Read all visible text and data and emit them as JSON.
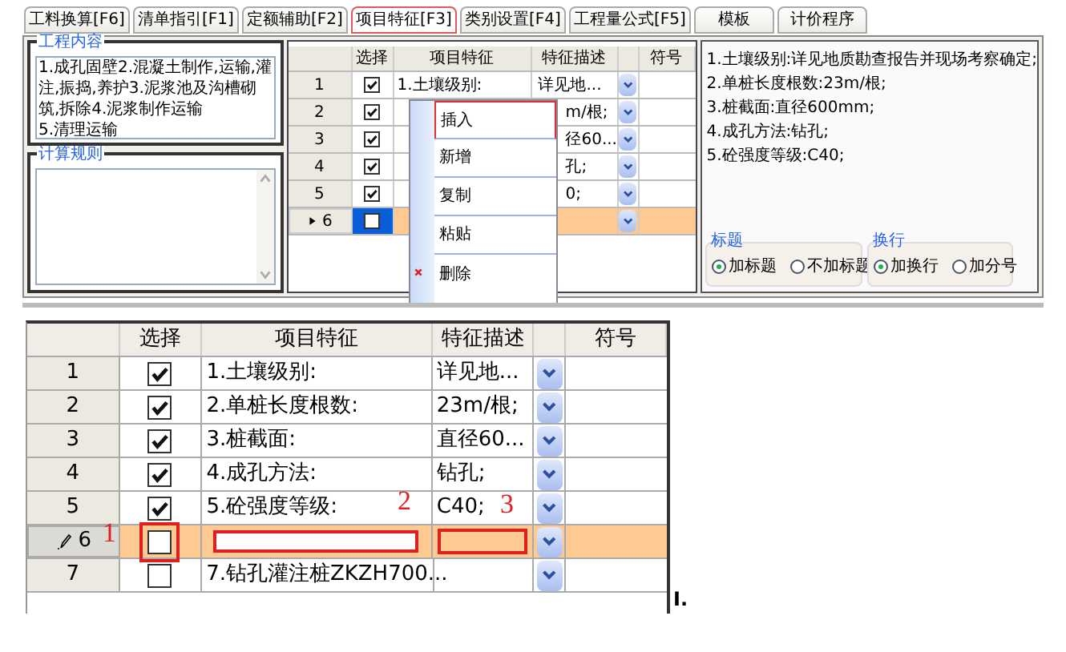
{
  "tabs": [
    {
      "label": "工料换算[F6]",
      "selected": false
    },
    {
      "label": "清单指引[F1]",
      "selected": false
    },
    {
      "label": "定额辅助[F2]",
      "selected": false
    },
    {
      "label": "项目特征[F3]",
      "selected": true
    },
    {
      "label": "类别设置[F4]",
      "selected": false
    },
    {
      "label": "工程量公式[F5]",
      "selected": false
    },
    {
      "label": "模板",
      "selected": false
    },
    {
      "label": "计价程序",
      "selected": false
    }
  ],
  "work_content": {
    "title": "工程内容",
    "text": "1.成孔固壁2.混凝土制作,运输,灌注,振捣,养护3.泥浆池及沟槽砌筑,拆除4.泥浆制作运输\n5.清理运输"
  },
  "calc_rules": {
    "title": "计算规则"
  },
  "top_grid": {
    "columns": [
      "选择",
      "项目特征",
      "特征描述",
      "符号"
    ],
    "rows": [
      {
        "number": "1",
        "checked": true,
        "item": "1.土壤级别:",
        "desc": "详见地...",
        "current": false
      },
      {
        "number": "2",
        "checked": true,
        "desc": "m/根;",
        "current": false
      },
      {
        "number": "3",
        "checked": true,
        "desc": "径60...",
        "current": false
      },
      {
        "number": "4",
        "checked": true,
        "desc": "孔;",
        "current": false
      },
      {
        "number": "5",
        "checked": true,
        "desc": "0;",
        "current": false
      },
      {
        "number": "6",
        "checked": false,
        "current": true
      }
    ]
  },
  "context_menu": {
    "items": [
      {
        "label": "插入",
        "selected": true,
        "kind": "plain"
      },
      {
        "label": "新增",
        "selected": false,
        "kind": "plain"
      },
      {
        "label": "复制",
        "selected": false,
        "kind": "plain"
      },
      {
        "label": "粘贴",
        "selected": false,
        "kind": "plain"
      },
      {
        "label": "删除",
        "selected": false,
        "kind": "delete"
      }
    ]
  },
  "description_panel": {
    "lines": [
      "1.土壤级别:详见地质勘查报告并现场考察确定;",
      "2.单桩长度根数:23m/根;",
      "3.桩截面:直径600mm;",
      "4.成孔方法:钻孔;",
      "5.砼强度等级:C40;"
    ]
  },
  "option_groups": [
    {
      "title": "标题",
      "options": [
        {
          "label": "加标题",
          "selected": true
        },
        {
          "label": "不加标题",
          "selected": false
        }
      ]
    },
    {
      "title": "换行",
      "options": [
        {
          "label": "加换行",
          "selected": true
        },
        {
          "label": "加分号",
          "selected": false
        }
      ]
    }
  ],
  "detail_grid": {
    "columns": [
      "选择",
      "项目特征",
      "特征描述",
      "符号"
    ],
    "rows": [
      {
        "number": "1",
        "checked": true,
        "item": "1.土壤级别:",
        "desc": "详见地...",
        "current": false
      },
      {
        "number": "2",
        "checked": true,
        "item": "2.单桩长度根数:",
        "desc": "23m/根;",
        "current": false
      },
      {
        "number": "3",
        "checked": true,
        "item": "3.桩截面:",
        "desc": "直径60...",
        "current": false
      },
      {
        "number": "4",
        "checked": true,
        "item": "4.成孔方法:",
        "desc": "钻孔;",
        "current": false
      },
      {
        "number": "5",
        "checked": true,
        "item": "5.砼强度等级:",
        "desc": "C40;",
        "current": false
      },
      {
        "number": "6",
        "checked": false,
        "current": true
      },
      {
        "number": "7",
        "checked": false,
        "item": "7.钻孔灌注桩ZKZH700...",
        "current": false
      }
    ]
  },
  "annotations": [
    "1",
    "2",
    "3"
  ],
  "cursor_mark": "I."
}
